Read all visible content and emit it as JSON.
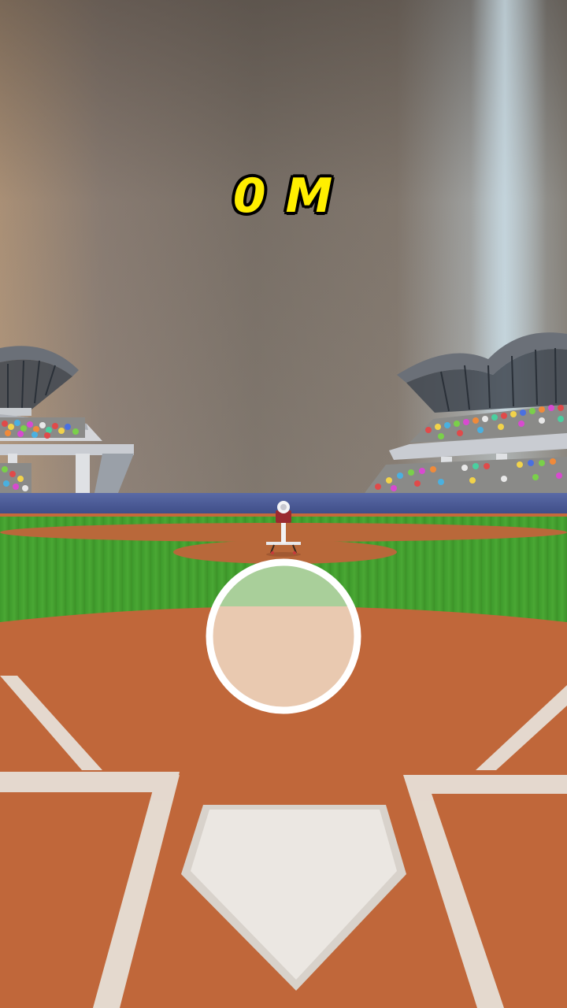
{
  "hud": {
    "distance_value": "0",
    "distance_unit": "M"
  },
  "colors": {
    "distance_text": "#ffee00",
    "grass": "#4aa834",
    "dirt": "#c56a3a",
    "wall": "#4a5a96",
    "target_ring": "#ffffff"
  },
  "icons": {
    "pitching_machine": "pitching-machine-icon",
    "home_plate": "home-plate-icon",
    "batting_target": "batting-target-icon"
  }
}
